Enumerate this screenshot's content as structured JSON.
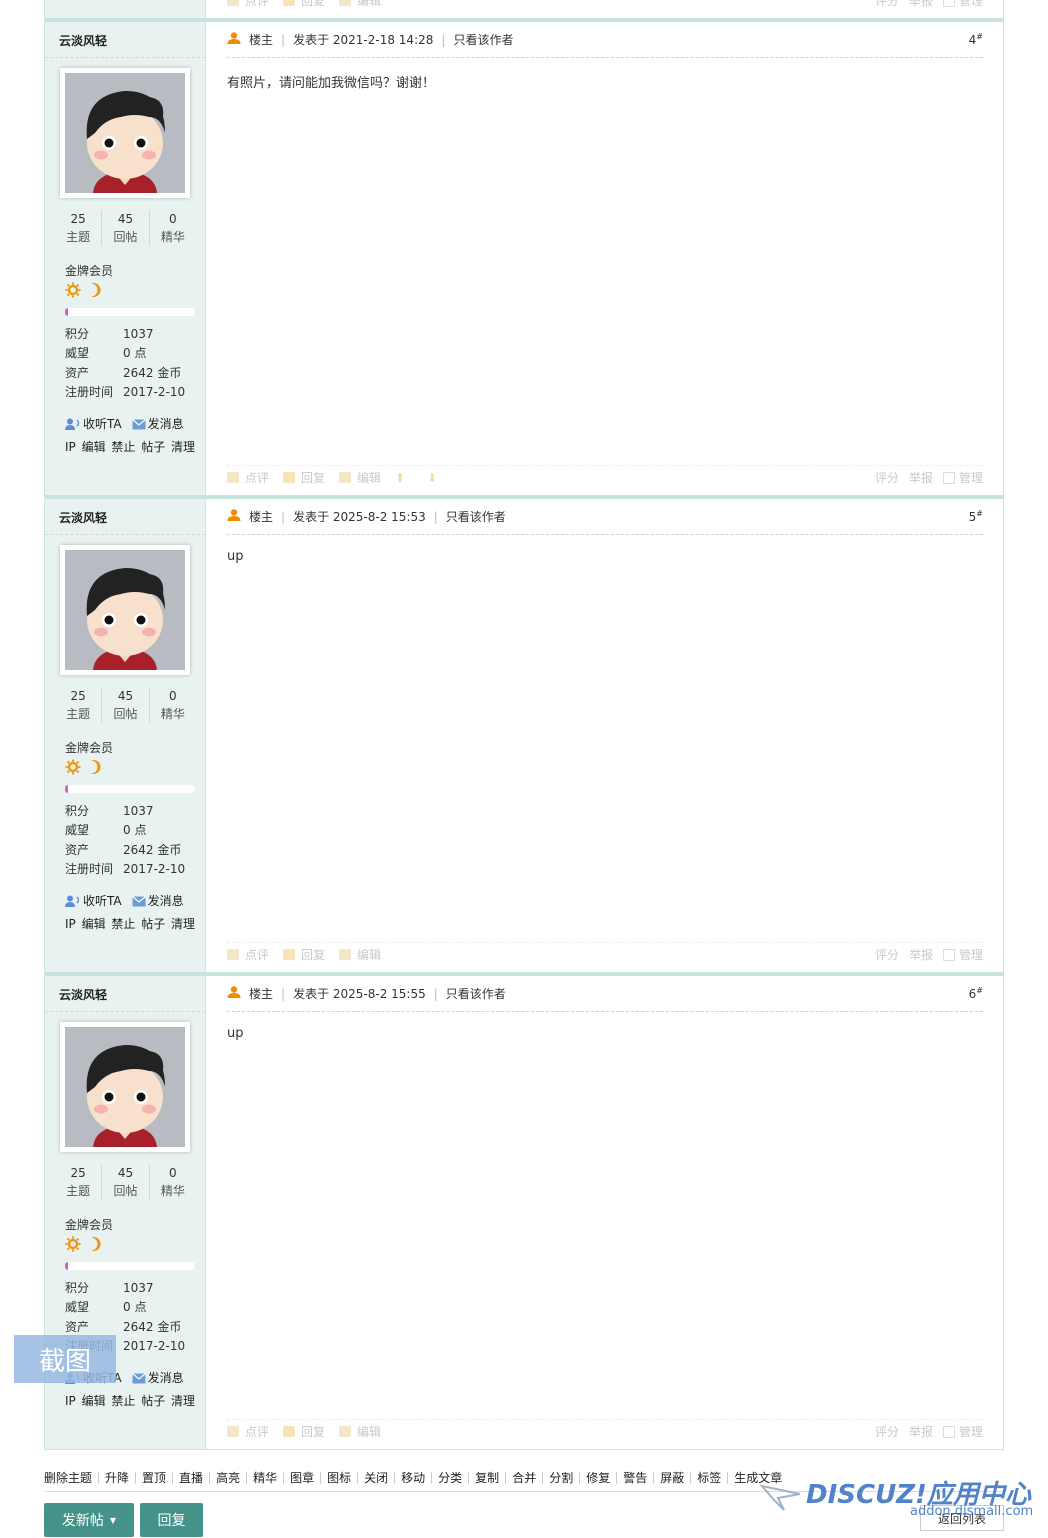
{
  "thread": {
    "prev_footer": {
      "actions": [
        "点评",
        "回复",
        "编辑"
      ],
      "right": [
        "评分",
        "举报",
        "管理"
      ]
    },
    "posts": [
      {
        "author": "云淡风轻",
        "stats": [
          {
            "num": "25",
            "label": "主题"
          },
          {
            "num": "45",
            "label": "回帖"
          },
          {
            "num": "0",
            "label": "精华"
          }
        ],
        "group": "金牌会员",
        "profile": [
          {
            "k": "积分",
            "v": "1037"
          },
          {
            "k": "威望",
            "v": "0 点"
          },
          {
            "k": "资产",
            "v": "2642 金币"
          },
          {
            "k": "注册时间",
            "v": "2017-2-10"
          }
        ],
        "follow": "收听TA",
        "pm": "发消息",
        "admin": "IP 编辑 禁止 帖子 清理",
        "role": "楼主",
        "posted": "发表于 2021-2-18 14:28",
        "only_author": "只看该作者",
        "floor": "4",
        "floor_sup": "#",
        "content": "有照片，请问能加我微信吗？谢谢！",
        "actions": [
          "点评",
          "回复",
          "编辑"
        ],
        "right": [
          "评分",
          "举报",
          "管理"
        ]
      },
      {
        "author": "云淡风轻",
        "stats": [
          {
            "num": "25",
            "label": "主题"
          },
          {
            "num": "45",
            "label": "回帖"
          },
          {
            "num": "0",
            "label": "精华"
          }
        ],
        "group": "金牌会员",
        "profile": [
          {
            "k": "积分",
            "v": "1037"
          },
          {
            "k": "威望",
            "v": "0 点"
          },
          {
            "k": "资产",
            "v": "2642 金币"
          },
          {
            "k": "注册时间",
            "v": "2017-2-10"
          }
        ],
        "follow": "收听TA",
        "pm": "发消息",
        "admin": "IP 编辑 禁止 帖子 清理",
        "role": "楼主",
        "posted": "发表于 2025-8-2 15:53",
        "only_author": "只看该作者",
        "floor": "5",
        "floor_sup": "#",
        "content": "up",
        "actions": [
          "点评",
          "回复",
          "编辑"
        ],
        "right": [
          "评分",
          "举报",
          "管理"
        ]
      },
      {
        "author": "云淡风轻",
        "stats": [
          {
            "num": "25",
            "label": "主题"
          },
          {
            "num": "45",
            "label": "回帖"
          },
          {
            "num": "0",
            "label": "精华"
          }
        ],
        "group": "金牌会员",
        "profile": [
          {
            "k": "积分",
            "v": "1037"
          },
          {
            "k": "威望",
            "v": "0 点"
          },
          {
            "k": "资产",
            "v": "2642 金币"
          },
          {
            "k": "注册时间",
            "v": "2017-2-10"
          }
        ],
        "follow": "收听TA",
        "pm": "发消息",
        "admin": "IP 编辑 禁止 帖子 清理",
        "role": "楼主",
        "posted": "发表于 2025-8-2 15:55",
        "only_author": "只看该作者",
        "floor": "6",
        "floor_sup": "#",
        "content": "up",
        "actions": [
          "点评",
          "回复",
          "编辑"
        ],
        "right": [
          "评分",
          "举报",
          "管理"
        ]
      }
    ]
  },
  "modbar": [
    "删除主题",
    "升降",
    "置顶",
    "直播",
    "高亮",
    "精华",
    "图章",
    "图标",
    "关闭",
    "移动",
    "分类",
    "复制",
    "合并",
    "分割",
    "修复",
    "警告",
    "屏蔽",
    "标签",
    "生成文章"
  ],
  "buttons": {
    "new_thread": "发新帖",
    "reply": "回复",
    "back_list": "返回列表"
  },
  "watermark": {
    "logo": "DISCUZ!应用中心",
    "sub": "addon.dismall.com"
  },
  "screenshot_tool": "截图",
  "colors": {
    "accent": "#45928a",
    "sidebar": "#e8f3f1",
    "border": "#c6e3de",
    "progress": "#e35ab4",
    "role_icon": "#f08c00"
  },
  "progress_fraction": 0.02
}
